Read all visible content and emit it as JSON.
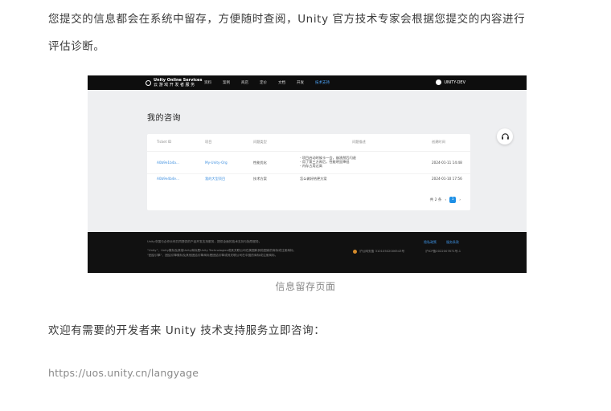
{
  "article": {
    "para1": "您提交的信息都会在系统中留存，方便随时查阅，Unity 官方技术专家会根据您提交的内容进行",
    "para2": "评估诊断。",
    "caption": "信息留存页面",
    "para3": "欢迎有需要的开发者来 Unity 技术支持服务立即咨询：",
    "link": "https://uos.unity.cn/langyage"
  },
  "screenshot": {
    "logo": {
      "line1": "Unity Online Services",
      "line2": "云 游 戏 开 发 者 服 务"
    },
    "nav": [
      "资料",
      "案例",
      "商店",
      "定价",
      "文档",
      "开发",
      "技术支持"
    ],
    "nav_active_index": 6,
    "user": "UNITY-DEV",
    "page_title": "我的咨询",
    "table": {
      "headers": [
        "Ticket ID",
        "项目",
        "问题类型",
        "问题描述",
        "创建时间"
      ],
      "rows": [
        {
          "id": "A0b9e1b4a...",
          "project": "My-Unity-Org",
          "type": "性能优化",
          "desc": [
            "- 项目启动时候卡一会，崩溃然后闪退",
            "- 用了第三方库后，性能明显降低",
            "- 内存占用过高"
          ],
          "created": "2024-01-11 14:48"
        },
        {
          "id": "A0b9e4b4e...",
          "project": "我的大型项目",
          "type": "技术方案",
          "desc": [
            "怎么做好热更方案"
          ],
          "created": "2024-01-10 17:56"
        }
      ]
    },
    "pager": {
      "total": "共 2 条",
      "prev": "‹",
      "page": "1",
      "next": "›"
    },
    "footer": {
      "line1": "Unity中国与合作伙伴共同提供的产品开发支持服务，提供全面的技术支持与指导服务。",
      "line2": "“Unity”、Unity徽标及其他Unity商标是Unity Technologies或其关联公司在美国和其他国家的商标或注册商标，",
      "line3": "“团结引擎”、团结引擎徽标及其他团结引擎商标是团结引擎或其关联公司在中国的商标或注册商标。",
      "links": [
        "隐私政策",
        "服务条款"
      ],
      "record": "沪公网安备 31010502006543号",
      "icp": "沪ICP备2022007671号-1"
    }
  }
}
